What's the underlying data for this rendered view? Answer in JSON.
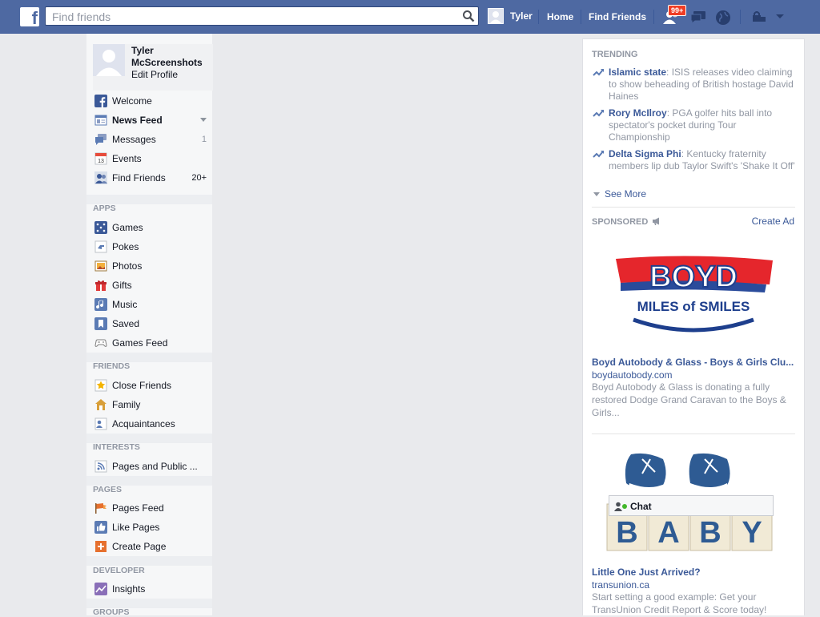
{
  "topbar": {
    "logo": "f",
    "search_placeholder": "Find friends",
    "user_name": "Tyler",
    "home_label": "Home",
    "find_friends_label": "Find Friends",
    "friend_requests_badge": "99+",
    "colors": {
      "bar": "#4e69a2",
      "badge": "#f03d25"
    }
  },
  "sidebar": {
    "profile": {
      "name": "Tyler McScreenshots",
      "edit_label": "Edit Profile"
    },
    "favorites": [
      {
        "label": "Welcome",
        "icon": "facebook-icon"
      },
      {
        "label": "News Feed",
        "icon": "news-feed-icon"
      },
      {
        "label": "Messages",
        "icon": "messages-icon",
        "count": "1"
      },
      {
        "label": "Events",
        "icon": "events-icon",
        "badge_text": "13"
      },
      {
        "label": "Find Friends",
        "icon": "find-friends-icon",
        "count": "20+"
      }
    ],
    "apps_heading": "APPS",
    "apps": [
      {
        "label": "Games",
        "icon": "games-icon"
      },
      {
        "label": "Pokes",
        "icon": "pokes-icon"
      },
      {
        "label": "Photos",
        "icon": "photos-icon"
      },
      {
        "label": "Gifts",
        "icon": "gifts-icon"
      },
      {
        "label": "Music",
        "icon": "music-icon"
      },
      {
        "label": "Saved",
        "icon": "saved-icon"
      },
      {
        "label": "Games Feed",
        "icon": "games-feed-icon"
      }
    ],
    "friends_heading": "FRIENDS",
    "friends": [
      {
        "label": "Close Friends",
        "icon": "close-friends-icon"
      },
      {
        "label": "Family",
        "icon": "family-icon"
      },
      {
        "label": "Acquaintances",
        "icon": "acquaintances-icon"
      }
    ],
    "interests_heading": "INTERESTS",
    "interests": [
      {
        "label": "Pages and Public ...",
        "icon": "pages-public-icon"
      }
    ],
    "pages_heading": "PAGES",
    "pages": [
      {
        "label": "Pages Feed",
        "icon": "pages-feed-icon"
      },
      {
        "label": "Like Pages",
        "icon": "like-pages-icon"
      },
      {
        "label": "Create Page",
        "icon": "create-page-icon"
      }
    ],
    "developer_heading": "DEVELOPER",
    "developer": [
      {
        "label": "Insights",
        "icon": "insights-icon"
      }
    ],
    "groups_heading": "GROUPS"
  },
  "trending": {
    "heading": "TRENDING",
    "items": [
      {
        "name": "Islamic state",
        "text": ": ISIS releases video claiming to show beheading of British hostage David Haines"
      },
      {
        "name": "Rory McIlroy",
        "text": ": PGA golfer hits ball into spectator's pocket during Tour Championship"
      },
      {
        "name": "Delta Sigma Phi",
        "text": ": Kentucky fraternity members lip dub Taylor Swift's 'Shake It Off'"
      }
    ],
    "see_more": "See More"
  },
  "sponsored": {
    "heading": "SPONSORED",
    "create_ad": "Create Ad",
    "ads": [
      {
        "image_text_top": "BOYD",
        "image_text_bottom": "MILES of SMILES",
        "title": "Boyd Autobody & Glass - Boys & Girls Clu...",
        "url": "boydautobody.com",
        "desc": "Boyd Autobody & Glass is donating a fully restored Dodge Grand Caravan to the Boys & Girls..."
      },
      {
        "image_letters": [
          "B",
          "A",
          "B",
          "Y"
        ],
        "title": "Little One Just Arrived?",
        "url": "transunion.ca",
        "desc": "Start setting a good example: Get your TransUnion Credit Report & Score today!"
      }
    ]
  },
  "chat": {
    "label": "Chat"
  }
}
